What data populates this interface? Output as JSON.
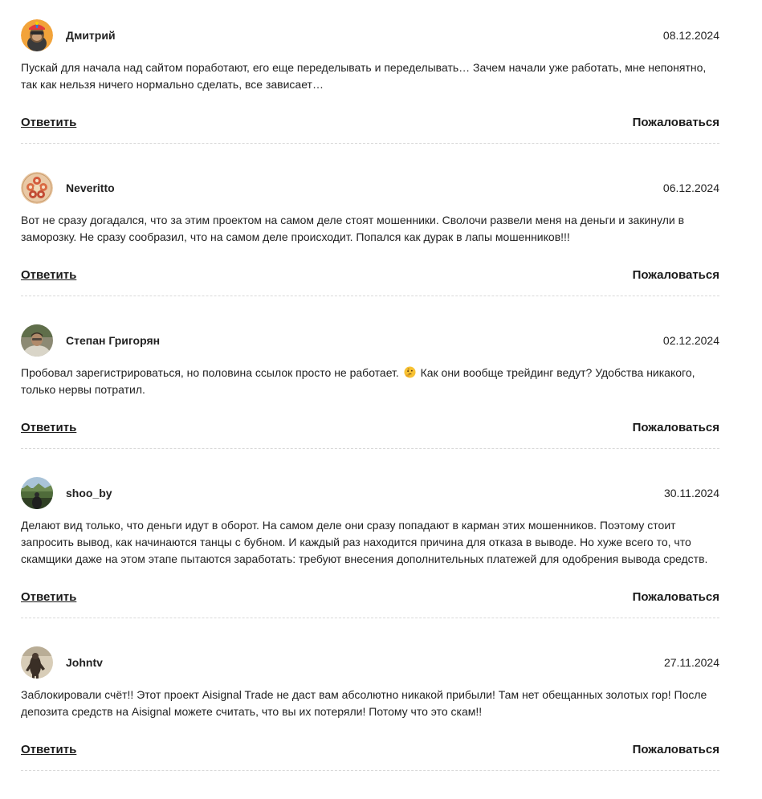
{
  "comments": [
    {
      "author": "Дмитрий",
      "date": "08.12.2024",
      "text": "Пускай для начала над сайтом поработают, его еще переделывать и переделывать… Зачем начали уже работать, мне непонятно, так как нельзя ничего нормально сделать, все зависает…",
      "reply_label": "Ответить",
      "report_label": "Пожаловаться",
      "avatar_icon": "cartoon-ape-avatar",
      "avatar_color": "#f2a33a"
    },
    {
      "author": "Neveritto",
      "date": "06.12.2024",
      "text": "Вот не сразу догадался, что за этим проектом на самом деле стоят мошенники. Сволочи развели меня на деньги и закинули в заморозку. Не сразу сообразил, что на самом деле происходит. Попался как дурак в лапы мошенников!!!",
      "reply_label": "Ответить",
      "report_label": "Пожаловаться",
      "avatar_icon": "dolls-pattern-avatar",
      "avatar_color": "#e9c9a6"
    },
    {
      "author": "Степан Григорян",
      "date": "02.12.2024",
      "text_before_emoji": "Пробовал зарегистрироваться, но половина ссылок просто не работает.",
      "emoji_icon": "thinking-face-emoji",
      "text_after_emoji": "Как они вообще трейдинг ведут? Удобства никакого, только нервы потратил.",
      "reply_label": "Ответить",
      "report_label": "Пожаловаться",
      "avatar_icon": "man-photo-avatar",
      "avatar_color": "#6f6a58"
    },
    {
      "author": "shoo_by",
      "date": "30.11.2024",
      "text": "Делают вид только, что деньги идут в оборот. На самом деле они сразу попадают в карман этих мошенников. Поэтому стоит запросить вывод, как начинаются танцы с бубном. И каждый раз находится причина для отказа в выводе. Но хуже всего то, что скамщики даже на этом этапе пытаются заработать: требуют внесения дополнительных платежей для одобрения вывода средств.",
      "reply_label": "Ответить",
      "report_label": "Пожаловаться",
      "avatar_icon": "landscape-photo-avatar",
      "avatar_color": "#4f6b3a"
    },
    {
      "author": "Johntv",
      "date": "27.11.2024",
      "text": "Заблокировали счёт!! Этот проект Aisignal Trade не даст вам абсолютно никакой прибыли! Там нет обещанных золотых гор! После депозита средств на Aisignal можете считать, что вы их потеряли! Потому что это скам!!",
      "reply_label": "Ответить",
      "report_label": "Пожаловаться",
      "avatar_icon": "figure-photo-avatar",
      "avatar_color": "#d8cdb8"
    }
  ]
}
